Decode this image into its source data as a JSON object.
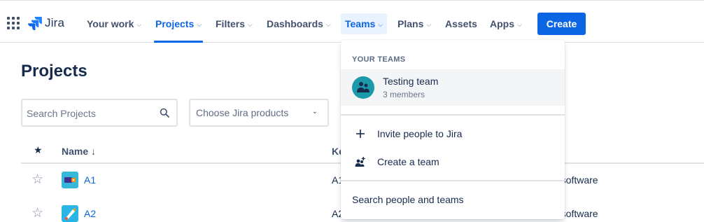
{
  "nav": {
    "logo_text": "Jira",
    "items": [
      {
        "label": "Your work"
      },
      {
        "label": "Projects"
      },
      {
        "label": "Filters"
      },
      {
        "label": "Dashboards"
      },
      {
        "label": "Teams"
      },
      {
        "label": "Plans"
      },
      {
        "label": "Assets"
      },
      {
        "label": "Apps"
      }
    ],
    "active_item": "Projects",
    "open_item": "Teams",
    "create_label": "Create"
  },
  "page": {
    "title": "Projects",
    "search_placeholder": "Search Projects",
    "product_filter_label": "Choose Jira products"
  },
  "table": {
    "columns": {
      "name": "Name ↓",
      "key": "Ke"
    },
    "rows": [
      {
        "name": "A1",
        "key": "A1",
        "type": "d software"
      },
      {
        "name": "A2",
        "key": "A2",
        "type": "d software"
      }
    ]
  },
  "teams_dropdown": {
    "heading": "YOUR TEAMS",
    "teams": [
      {
        "name": "Testing team",
        "members": "3 members"
      }
    ],
    "invite_label": "Invite people to Jira",
    "create_team_label": "Create a team",
    "search_label": "Search people and teams"
  },
  "colors": {
    "brand_blue": "#0c66e4",
    "team_avatar": "#1d9aaa"
  }
}
